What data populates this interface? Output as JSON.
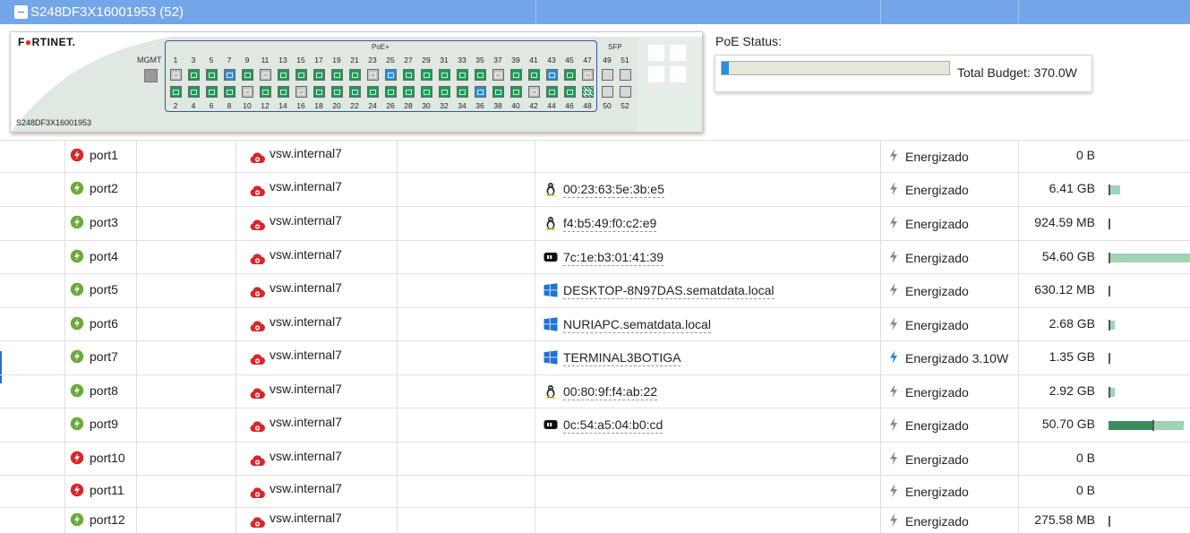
{
  "header": {
    "title": "S248DF3X16001953 (52)"
  },
  "switch": {
    "logo_left": "F",
    "logo_red": "●",
    "logo_rest": "RTINET.",
    "model": "S248DF3X16001953",
    "mgmt_label": "MGMT",
    "poe_label": "PoE+",
    "sfp_label": "SFP",
    "top_numbers": [
      "1",
      "3",
      "5",
      "7",
      "9",
      "11",
      "13",
      "15",
      "17",
      "19",
      "21",
      "23",
      "25",
      "27",
      "29",
      "31",
      "33",
      "35",
      "37",
      "39",
      "41",
      "43",
      "45",
      "47"
    ],
    "bottom_numbers": [
      "2",
      "4",
      "6",
      "8",
      "10",
      "12",
      "14",
      "16",
      "18",
      "20",
      "22",
      "24",
      "26",
      "28",
      "30",
      "32",
      "34",
      "36",
      "38",
      "40",
      "42",
      "44",
      "46",
      "48"
    ],
    "top_states": [
      "down",
      "up",
      "up",
      "blue",
      "up",
      "down",
      "up",
      "up",
      "up",
      "up",
      "up",
      "down",
      "blue",
      "up",
      "up",
      "up",
      "up",
      "up",
      "down",
      "up",
      "up",
      "blue",
      "up",
      "down"
    ],
    "bottom_states": [
      "up",
      "up",
      "up",
      "up",
      "down",
      "up",
      "up",
      "down",
      "up",
      "up",
      "up",
      "up",
      "up",
      "up",
      "up",
      "up",
      "up",
      "blue",
      "up",
      "up",
      "down",
      "up",
      "up",
      "hatch"
    ],
    "sfp_top_numbers": [
      "49",
      "51"
    ],
    "sfp_bottom_numbers": [
      "50",
      "52"
    ]
  },
  "poe_status": {
    "title": "PoE Status:",
    "budget": "Total Budget: 370.0W",
    "usage_fraction": 0.03
  },
  "rows": [
    {
      "port": "port1",
      "status": "down",
      "vsw": "vsw.internal7",
      "device": "",
      "device_icon": "",
      "poe": "Energizado",
      "poe_active": false,
      "bytes": "0 B",
      "bar": 0
    },
    {
      "port": "port2",
      "status": "up",
      "vsw": "vsw.internal7",
      "device": "00:23:63:5e:3b:e5",
      "device_icon": "linux-icon",
      "poe": "Energizado",
      "poe_active": false,
      "bytes": "6.41 GB",
      "bar": 0.12
    },
    {
      "port": "port3",
      "status": "up",
      "vsw": "vsw.internal7",
      "device": "f4:b5:49:f0:c2:e9",
      "device_icon": "linux-icon",
      "poe": "Energizado",
      "poe_active": false,
      "bytes": "924.59 MB",
      "bar": 0.01
    },
    {
      "port": "port4",
      "status": "up",
      "vsw": "vsw.internal7",
      "device": "7c:1e:b3:01:41:39",
      "device_icon": "device-icon",
      "poe": "Energizado",
      "poe_active": false,
      "bytes": "54.60 GB",
      "bar": 1.0
    },
    {
      "port": "port5",
      "status": "up",
      "vsw": "vsw.internal7",
      "device": "DESKTOP-8N97DAS.sematdata.local",
      "device_icon": "windows-icon",
      "poe": "Energizado",
      "poe_active": false,
      "bytes": "630.12 MB",
      "bar": 0.01
    },
    {
      "port": "port6",
      "status": "up",
      "vsw": "vsw.internal7",
      "device": "NURIAPC.sematdata.local",
      "device_icon": "windows-icon",
      "poe": "Energizado",
      "poe_active": false,
      "bytes": "2.68 GB",
      "bar": 0.05
    },
    {
      "port": "port7",
      "status": "up",
      "vsw": "vsw.internal7",
      "device": "TERMINAL3BOTIGA",
      "device_icon": "windows-icon",
      "poe": "Energizado 3.10W",
      "poe_active": true,
      "bytes": "1.35 GB",
      "bar": 0.02
    },
    {
      "port": "port8",
      "status": "up",
      "vsw": "vsw.internal7",
      "device": "00:80:9f:f4:ab:22",
      "device_icon": "linux-icon",
      "poe": "Energizado",
      "poe_active": false,
      "bytes": "2.92 GB",
      "bar": 0.05
    },
    {
      "port": "port9",
      "status": "up",
      "vsw": "vsw.internal7",
      "device": "0c:54:a5:04:b0:cd",
      "device_icon": "device-icon",
      "poe": "Energizado",
      "poe_active": false,
      "bytes": "50.70 GB",
      "bar": 0.93,
      "bar_dark": 0.55
    },
    {
      "port": "port10",
      "status": "down",
      "vsw": "vsw.internal7",
      "device": "",
      "device_icon": "",
      "poe": "Energizado",
      "poe_active": false,
      "bytes": "0 B",
      "bar": 0
    },
    {
      "port": "port11",
      "status": "down",
      "vsw": "vsw.internal7",
      "device": "",
      "device_icon": "",
      "poe": "Energizado",
      "poe_active": false,
      "bytes": "0 B",
      "bar": 0
    },
    {
      "port": "port12",
      "status": "up",
      "vsw": "vsw.internal7",
      "device": "",
      "device_icon": "",
      "poe": "Energizado",
      "poe_active": false,
      "bytes": "275.58 MB",
      "bar": 0.01
    }
  ],
  "colors": {
    "up": "#6aaa3a",
    "down": "#d9262c",
    "accent": "#72a6e8",
    "bar": "#9ed3b4"
  }
}
